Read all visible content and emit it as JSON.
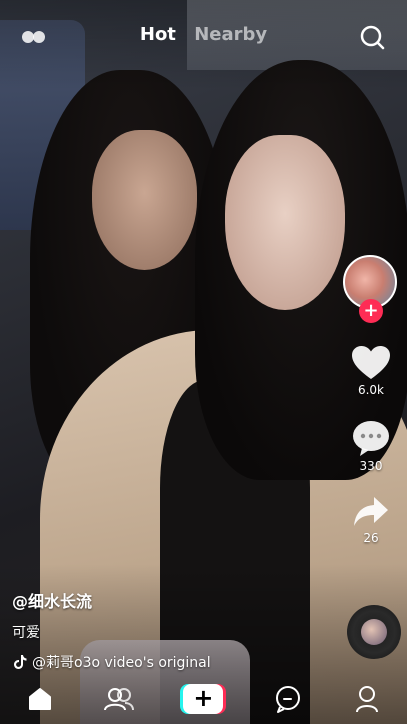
{
  "top_bar": {
    "tabs": [
      {
        "label": "Hot",
        "active": true
      },
      {
        "label": "Nearby",
        "active": false
      }
    ],
    "left_icon": "live-icon",
    "right_icon": "search-icon"
  },
  "video": {
    "username": "@细水长流",
    "caption": "可爱",
    "music": "@莉哥o3o video's original",
    "music_icon": "tiktok-note-icon"
  },
  "actions": {
    "follow_symbol": "+",
    "likes": "6.0k",
    "comments": "330",
    "shares": "26"
  },
  "bottom_nav": {
    "items": [
      "home-icon",
      "friends-icon",
      "create-icon",
      "messages-icon",
      "profile-icon"
    ],
    "create_symbol": "+"
  },
  "colors": {
    "accent_red": "#fe2c55",
    "accent_cyan": "#25f4ee"
  }
}
